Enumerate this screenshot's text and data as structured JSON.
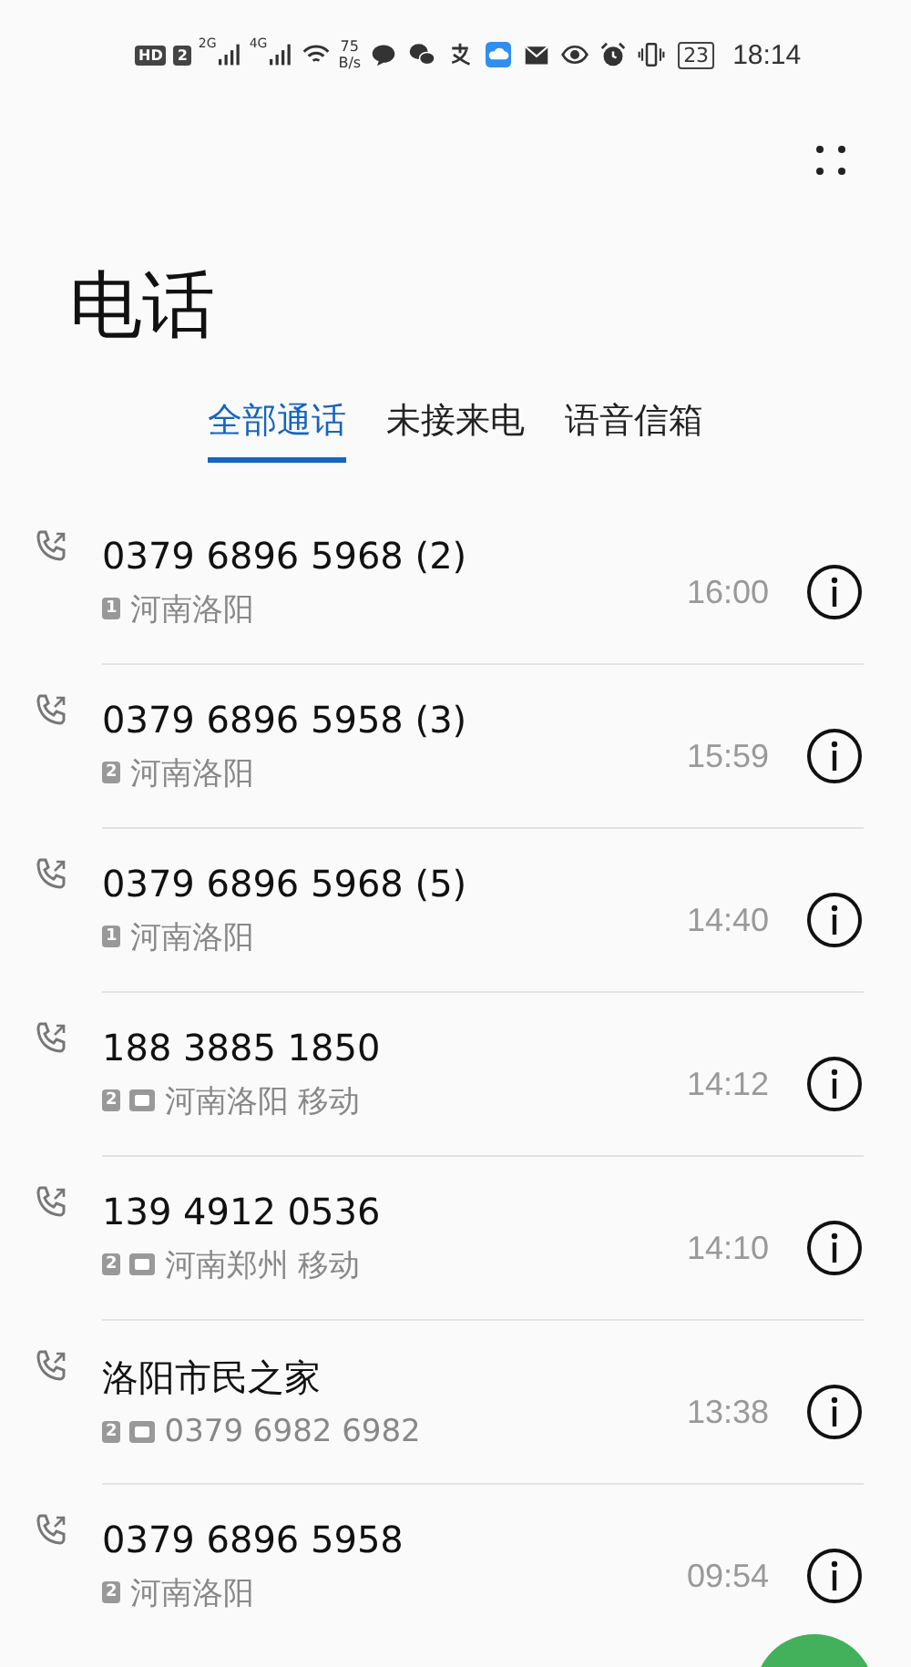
{
  "status_bar": {
    "hd": "HD",
    "sim": "2",
    "networks": [
      "2G",
      "4G"
    ],
    "speed_value": "75",
    "speed_unit": "B/s",
    "battery": "23",
    "time": "18:14"
  },
  "title": "电话",
  "tabs": [
    {
      "label": "全部通话",
      "selected": true
    },
    {
      "label": "未接来电",
      "selected": false
    },
    {
      "label": "语音信箱",
      "selected": false
    }
  ],
  "calls": [
    {
      "number": "0379 6896 5968 (2)",
      "sim": "1",
      "hd": false,
      "location": "河南洛阳",
      "time": "16:00"
    },
    {
      "number": "0379 6896 5958 (3)",
      "sim": "2",
      "hd": false,
      "location": "河南洛阳",
      "time": "15:59"
    },
    {
      "number": "0379 6896 5968 (5)",
      "sim": "1",
      "hd": false,
      "location": "河南洛阳",
      "time": "14:40"
    },
    {
      "number": "188 3885 1850",
      "sim": "2",
      "hd": true,
      "location": "河南洛阳 移动",
      "time": "14:12"
    },
    {
      "number": "139 4912 0536",
      "sim": "2",
      "hd": true,
      "location": "河南郑州 移动",
      "time": "14:10"
    },
    {
      "number": "洛阳市民之家",
      "sim": "2",
      "hd": true,
      "location": "0379 6982 6982",
      "time": "13:38"
    },
    {
      "number": "0379 6896 5958",
      "sim": "2",
      "hd": false,
      "location": "河南洛阳",
      "time": "09:54"
    }
  ]
}
